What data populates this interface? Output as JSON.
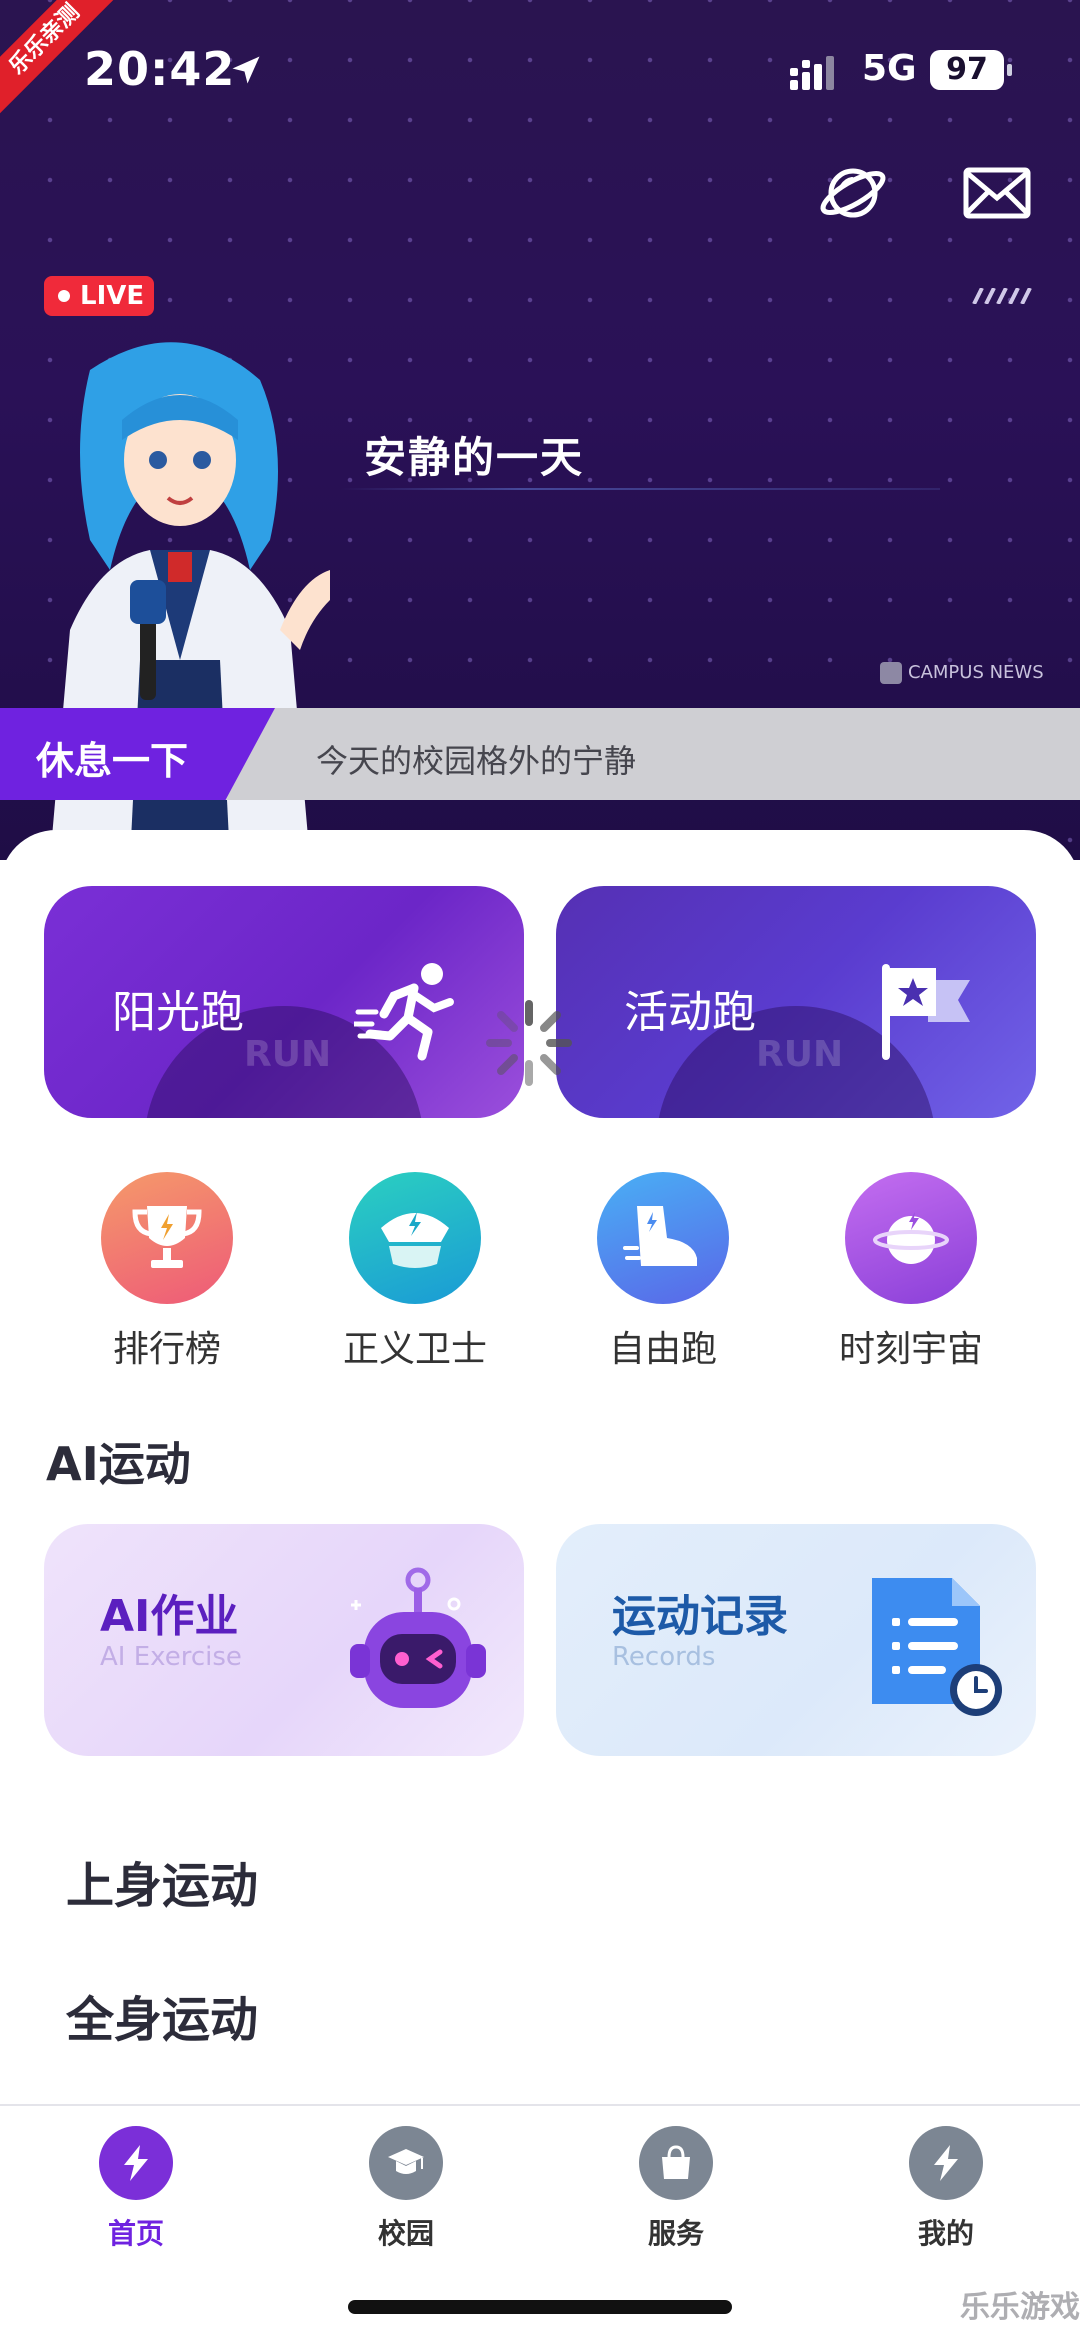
{
  "status_bar": {
    "time": "20:42",
    "network": "5G",
    "battery": "97"
  },
  "corner_badge": "乐乐亲测",
  "banner": {
    "live_label": "LIVE",
    "headline": "安静的一天",
    "brand": "CAMPUS NEWS",
    "ticker_tag": "休息一下",
    "ticker_text": "今天的校园格外的宁静"
  },
  "run_cards": [
    {
      "label": "阳光跑",
      "bg_word": "RUN",
      "icon": "runner-icon"
    },
    {
      "label": "活动跑",
      "bg_word": "RUN",
      "icon": "flag-icon"
    }
  ],
  "quick_actions": [
    {
      "label": "排行榜",
      "icon": "trophy-icon",
      "color": "#f0706a"
    },
    {
      "label": "正义卫士",
      "icon": "police-cap-icon",
      "color": "#23b5c8"
    },
    {
      "label": "自由跑",
      "icon": "sneaker-icon",
      "color": "#4b8cf0"
    },
    {
      "label": "时刻宇宙",
      "icon": "planet-icon",
      "color": "#a552e0"
    }
  ],
  "ai_section": {
    "title": "AI运动",
    "cards": [
      {
        "title": "AI作业",
        "subtitle": "AI Exercise",
        "icon": "robot-icon"
      },
      {
        "title": "运动记录",
        "subtitle": "Records",
        "icon": "document-clock-icon"
      }
    ]
  },
  "sections": [
    "上身运动",
    "全身运动"
  ],
  "tabbar": {
    "items": [
      {
        "label": "首页",
        "icon": "lightning-icon",
        "active": true
      },
      {
        "label": "校园",
        "icon": "graduation-cap-icon",
        "active": false
      },
      {
        "label": "服务",
        "icon": "shopping-bag-icon",
        "active": false
      },
      {
        "label": "我的",
        "icon": "lightning-icon",
        "active": false
      }
    ]
  },
  "watermark": "乐乐游戏",
  "colors": {
    "accent": "#6f22e0",
    "live": "#f02a3a",
    "hero_bg": "#2a1157"
  }
}
